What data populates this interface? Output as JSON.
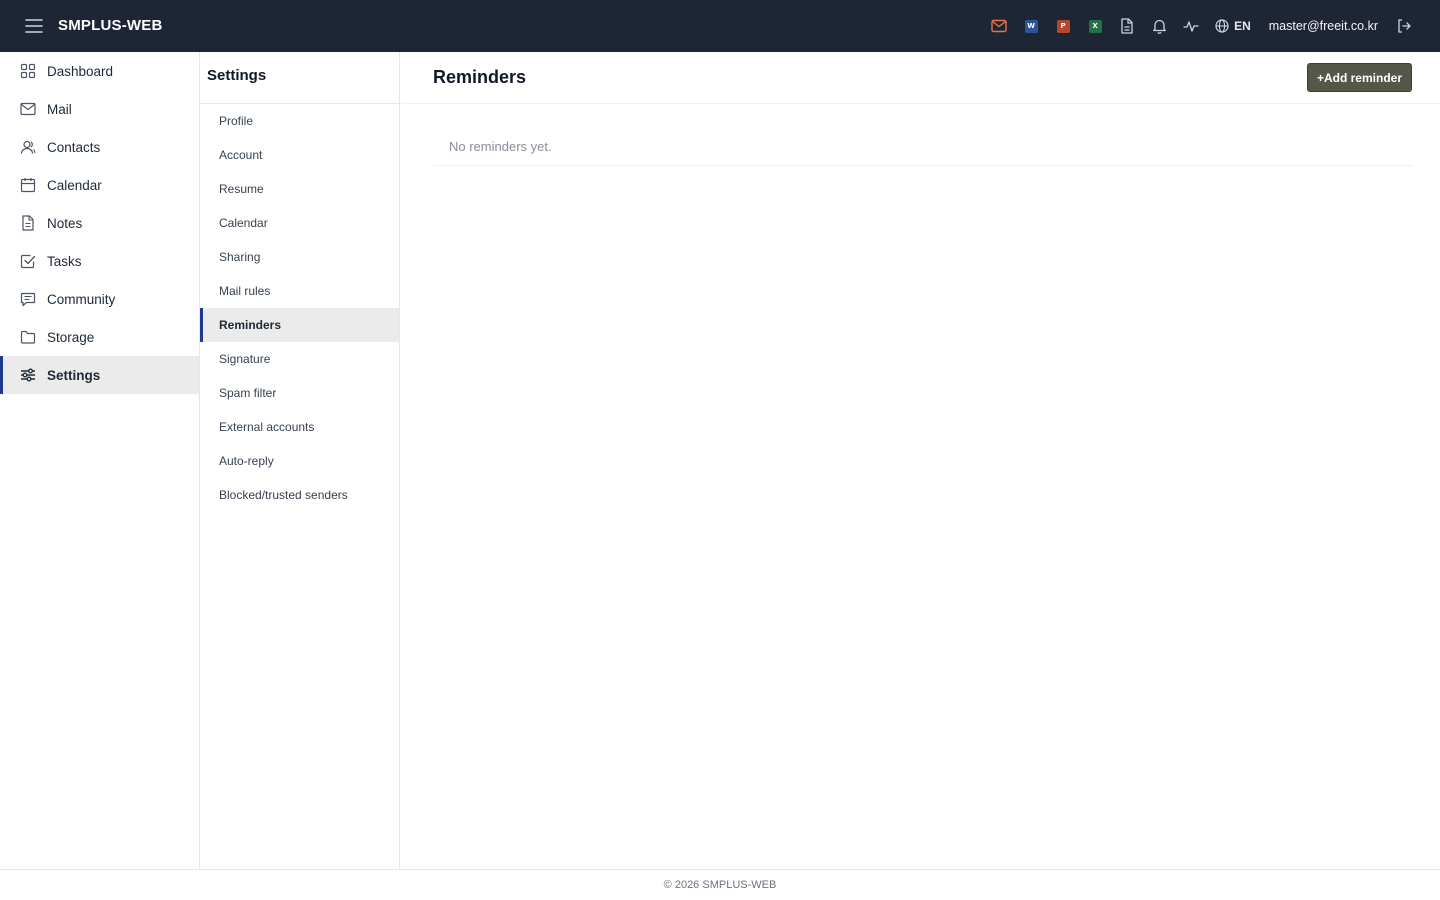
{
  "app": {
    "brand": "SMPLUS-WEB"
  },
  "topbar": {
    "office": {
      "word": "W",
      "powerpoint": "P",
      "excel": "X"
    },
    "language": "EN",
    "user_email": "master@freeit.co.kr"
  },
  "sidebar": {
    "items": [
      {
        "label": "Dashboard",
        "icon": "dashboard-icon"
      },
      {
        "label": "Mail",
        "icon": "mail-icon"
      },
      {
        "label": "Contacts",
        "icon": "contacts-icon"
      },
      {
        "label": "Calendar",
        "icon": "calendar-icon"
      },
      {
        "label": "Notes",
        "icon": "notes-icon"
      },
      {
        "label": "Tasks",
        "icon": "tasks-icon"
      },
      {
        "label": "Community",
        "icon": "community-icon"
      },
      {
        "label": "Storage",
        "icon": "folder-icon"
      },
      {
        "label": "Settings",
        "icon": "settings-sliders-icon",
        "active": true
      }
    ]
  },
  "subnav": {
    "title": "Settings",
    "items": [
      {
        "label": "Profile"
      },
      {
        "label": "Account"
      },
      {
        "label": "Resume"
      },
      {
        "label": "Calendar"
      },
      {
        "label": "Sharing"
      },
      {
        "label": "Mail rules"
      },
      {
        "label": "Reminders",
        "active": true
      },
      {
        "label": "Signature"
      },
      {
        "label": "Spam filter"
      },
      {
        "label": "External accounts"
      },
      {
        "label": "Auto-reply"
      },
      {
        "label": "Blocked/trusted senders"
      }
    ]
  },
  "main": {
    "title": "Reminders",
    "add_button_label": "+Add reminder",
    "empty_text": "No reminders yet."
  },
  "footer": {
    "text": "© 2026 SMPLUS-WEB"
  },
  "colors": {
    "topbar_bg": "#1e2636",
    "accent": "#1e3a8a",
    "add_button_bg": "#555848",
    "mail_icon": "#e8744a",
    "word": "#2b579a",
    "powerpoint": "#b7472a",
    "excel": "#217346"
  }
}
